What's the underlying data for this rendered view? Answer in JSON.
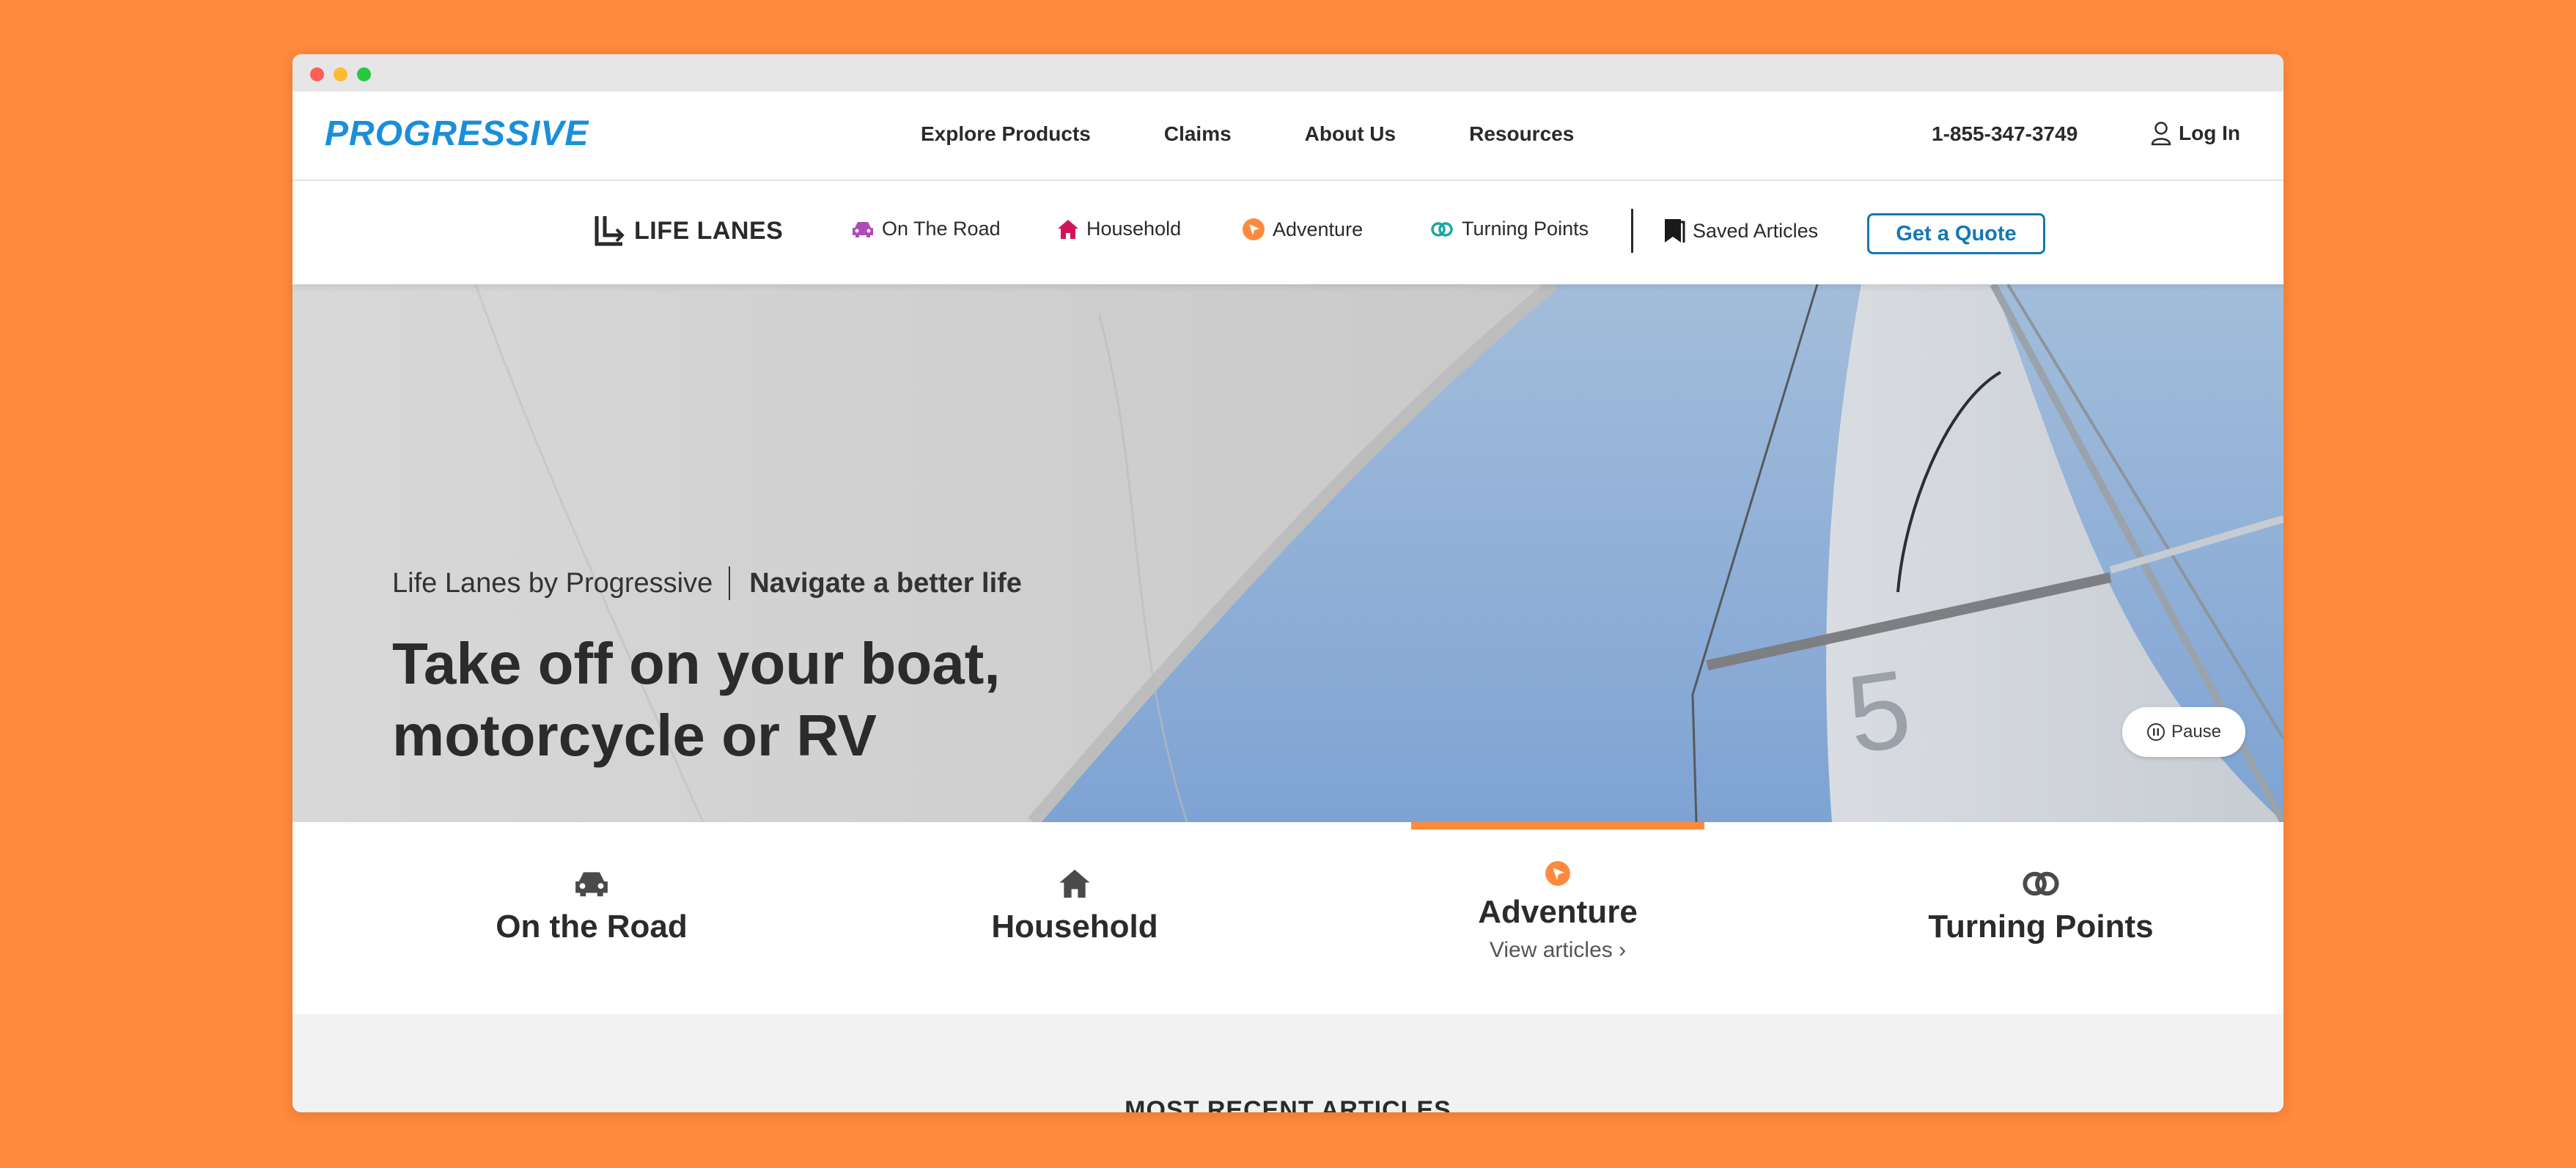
{
  "brand": {
    "logo_text": "PROGRESSIVE",
    "accent": "#1a8fd9"
  },
  "topnav": {
    "items": [
      {
        "label": "Explore Products"
      },
      {
        "label": "Claims"
      },
      {
        "label": "About Us"
      },
      {
        "label": "Resources"
      }
    ],
    "phone": "1-855-347-3749",
    "login_label": "Log In"
  },
  "subnav": {
    "brand": "LIFE LANES",
    "items": [
      {
        "label": "On The Road",
        "icon": "car-icon",
        "color": "#b04ab8"
      },
      {
        "label": "Household",
        "icon": "house-icon",
        "color": "#d4145a"
      },
      {
        "label": "Adventure",
        "icon": "compass-icon",
        "color": "#ff8a3d"
      },
      {
        "label": "Turning Points",
        "icon": "rings-icon",
        "color": "#1aa8a0"
      }
    ],
    "saved_label": "Saved Articles",
    "quote_label": "Get a Quote"
  },
  "hero": {
    "tagline_left": "Life Lanes by Progressive",
    "tagline_right": "Navigate a better life",
    "headline_line1": "Take off on your boat,",
    "headline_line2": "motorcycle or RV",
    "pause_label": "Pause",
    "sail_number": "5"
  },
  "categories": {
    "items": [
      {
        "label": "On the Road",
        "icon": "car-icon"
      },
      {
        "label": "Household",
        "icon": "house-icon"
      },
      {
        "label": "Adventure",
        "icon": "compass-icon",
        "active": true,
        "link": "View articles ›"
      },
      {
        "label": "Turning Points",
        "icon": "rings-icon"
      }
    ],
    "active_color": "#ff8a3d"
  },
  "recent": {
    "title": "MOST RECENT ARTICLES"
  }
}
